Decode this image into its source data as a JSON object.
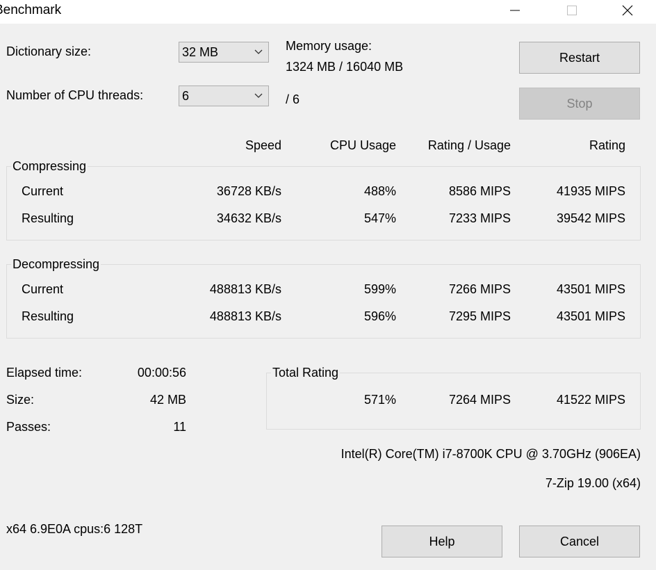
{
  "window": {
    "title": "Benchmark",
    "minimize_icon": "minimize-icon",
    "maximize_icon": "maximize-icon",
    "close_icon": "close-icon"
  },
  "settings": {
    "dictionary_label": "Dictionary size:",
    "dictionary_value": "32 MB",
    "threads_label": "Number of CPU threads:",
    "threads_value": "6",
    "threads_max": "/ 6",
    "memory_label": "Memory usage:",
    "memory_value": "1324 MB / 16040 MB"
  },
  "buttons": {
    "restart": "Restart",
    "stop": "Stop",
    "help": "Help",
    "cancel": "Cancel"
  },
  "columns": [
    "Speed",
    "CPU Usage",
    "Rating / Usage",
    "Rating"
  ],
  "compressing": {
    "title": "Compressing",
    "rows": [
      {
        "label": "Current",
        "speed": "36728 KB/s",
        "cpu": "488%",
        "rating_usage": "8586 MIPS",
        "rating": "41935 MIPS"
      },
      {
        "label": "Resulting",
        "speed": "34632 KB/s",
        "cpu": "547%",
        "rating_usage": "7233 MIPS",
        "rating": "39542 MIPS"
      }
    ]
  },
  "decompressing": {
    "title": "Decompressing",
    "rows": [
      {
        "label": "Current",
        "speed": "488813 KB/s",
        "cpu": "599%",
        "rating_usage": "7266 MIPS",
        "rating": "43501 MIPS"
      },
      {
        "label": "Resulting",
        "speed": "488813 KB/s",
        "cpu": "596%",
        "rating_usage": "7295 MIPS",
        "rating": "43501 MIPS"
      }
    ]
  },
  "stats": {
    "elapsed_label": "Elapsed time:",
    "elapsed_value": "00:00:56",
    "size_label": "Size:",
    "size_value": "42 MB",
    "passes_label": "Passes:",
    "passes_value": "11"
  },
  "total": {
    "title": "Total Rating",
    "cpu": "571%",
    "rating_usage": "7264 MIPS",
    "rating": "41522 MIPS"
  },
  "system": {
    "cpu_name": "Intel(R) Core(TM) i7-8700K CPU @ 3.70GHz (906EA)",
    "version": "7-Zip 19.00 (x64)",
    "sysinfo": "x64 6.9E0A cpus:6 128T"
  },
  "colors": {
    "background": "#f0f0f0",
    "titlebar": "#ffffff",
    "button": "#e1e1e1",
    "button_disabled": "#cccccc",
    "group_border": "#dcdcdc"
  }
}
